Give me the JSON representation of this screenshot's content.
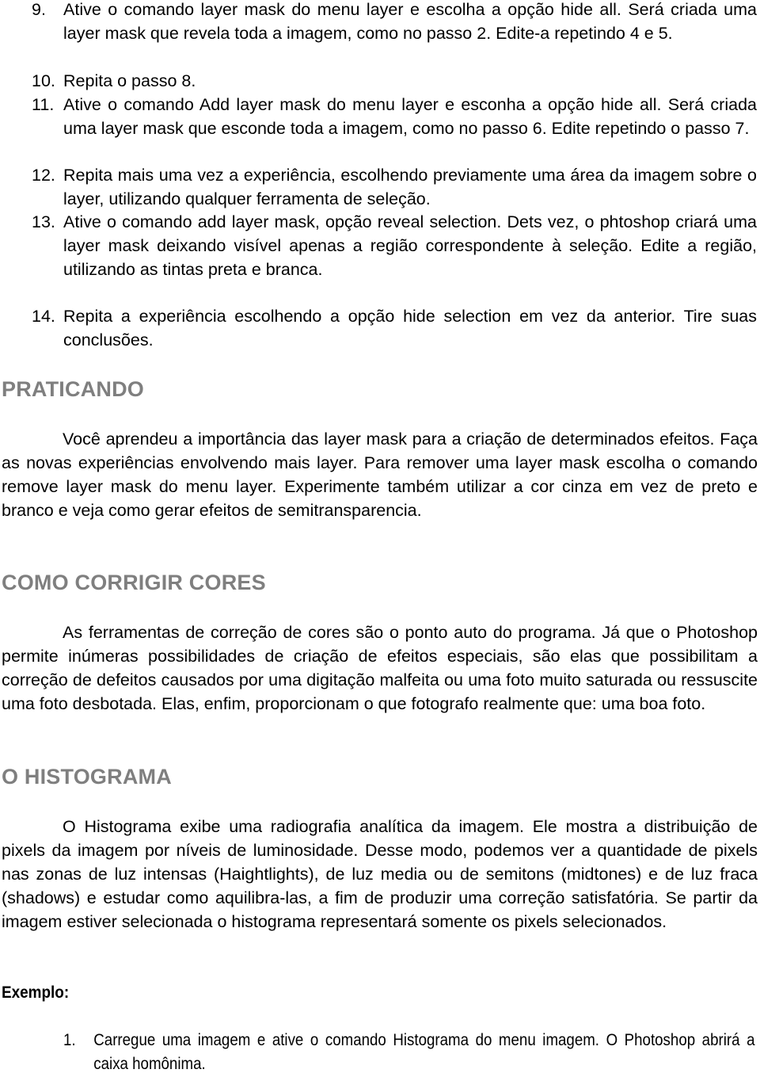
{
  "list_items": [
    {
      "num": "9.",
      "text": "Ative o comando layer mask do menu layer e escolha a opção hide all. Será criada uma layer mask que revela toda a imagem, como no passo 2. Edite-a repetindo 4 e 5."
    },
    {
      "num": "10.",
      "text": "Repita o passo 8."
    },
    {
      "num": "11.",
      "text": "Ative o comando Add layer mask do menu layer e esconha a opção hide all. Será criada uma layer mask que esconde toda a imagem, como no passo 6. Edite repetindo o passo 7."
    },
    {
      "num": "12.",
      "text": "Repita mais uma vez a experiência, escolhendo previamente uma área da imagem sobre o layer, utilizando qualquer ferramenta de seleção."
    },
    {
      "num": "13.",
      "text": "Ative o comando add layer mask, opção reveal selection. Dets vez, o phtoshop criará uma layer mask deixando visível apenas a região correspondente à seleção. Edite a região, utilizando as tintas preta e branca."
    },
    {
      "num": "14.",
      "text": "Repita a experiência escolhendo a opção hide selection em vez da anterior. Tire suas conclusões."
    }
  ],
  "sections": [
    {
      "heading": "PRATICANDO",
      "paragraph": "Você aprendeu a importância das layer mask para a criação de determinados efeitos. Faça as novas experiências envolvendo mais layer. Para remover uma layer mask escolha o comando remove layer mask do menu layer. Experimente também utilizar a cor cinza em vez de preto e branco e veja como gerar efeitos de semitransparencia."
    },
    {
      "heading": "COMO CORRIGIR CORES",
      "paragraph": "As ferramentas de correção de cores são o ponto auto do programa. Já que o Photoshop permite inúmeras possibilidades de criação de efeitos especiais, são elas que possibilitam a correção de defeitos causados por uma digitação malfeita ou uma foto muito saturada ou ressuscite uma foto desbotada. Elas, enfim, proporcionam o que fotografo realmente que: uma boa foto."
    },
    {
      "heading": "O HISTOGRAMA",
      "paragraph": "O Histograma exibe uma radiografia analítica da imagem. Ele mostra a distribuição de pixels da imagem por níveis de luminosidade. Desse modo, podemos ver a quantidade de pixels nas zonas de luz intensas (Haightlights), de luz media ou de semitons (midtones) e de luz fraca (shadows) e estudar como aquilibra-las, a fim de produzir uma correção satisfatória. Se partir da imagem estiver selecionada o histograma representará somente os pixels selecionados."
    }
  ],
  "example": {
    "label": "Exemplo:",
    "items": [
      {
        "num": "1.",
        "text": "Carregue uma imagem e ative o comando Histograma do menu imagem. O Photoshop abrirá a caixa homônima."
      }
    ]
  }
}
